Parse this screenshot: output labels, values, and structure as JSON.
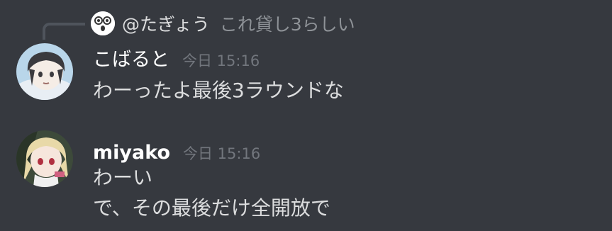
{
  "reply": {
    "author": "@たぎょう",
    "text": "これ貸し3らしい"
  },
  "messages": [
    {
      "username": "こばると",
      "timestamp": "今日 15:16",
      "lines": [
        "わーったよ最後3ラウンドな"
      ]
    },
    {
      "username": "miyako",
      "timestamp": "今日 15:16",
      "lines": [
        "わーい",
        "で、その最後だけ全開放で"
      ]
    }
  ],
  "colors": {
    "background": "#36393f",
    "text": "#dcddde",
    "username": "#ffffff",
    "muted": "#72767d",
    "reply_line": "#4f545c"
  }
}
